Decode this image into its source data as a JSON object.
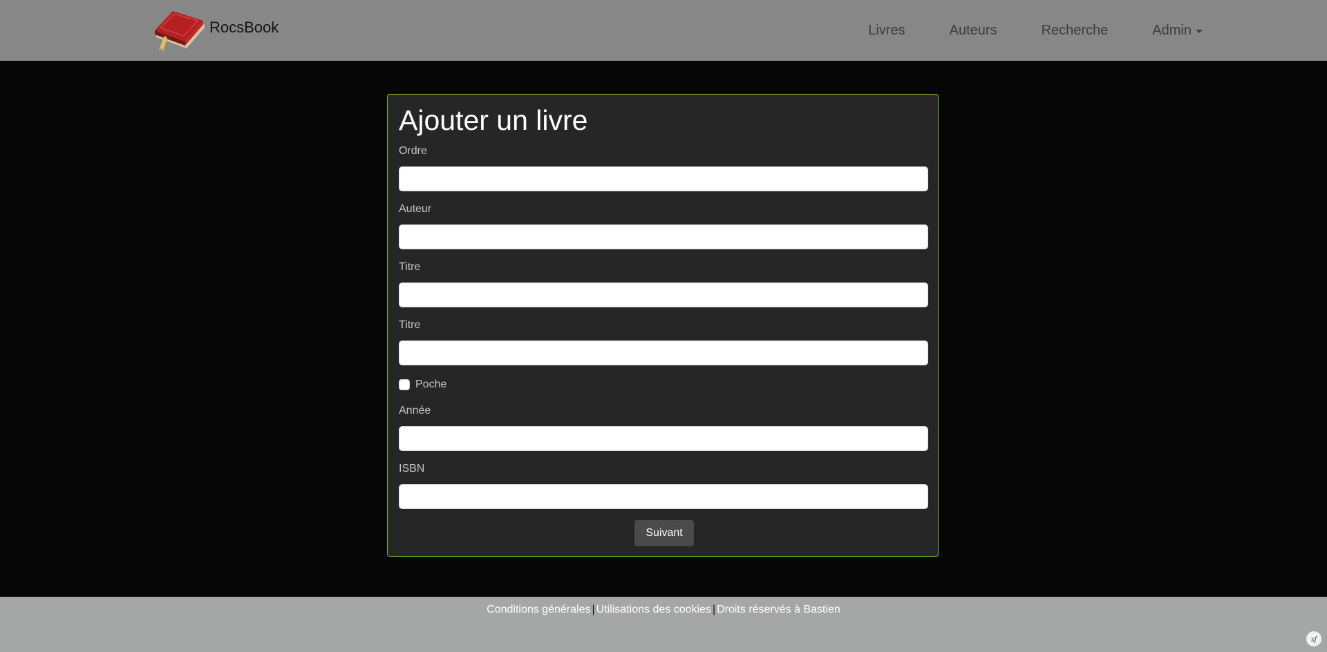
{
  "navbar": {
    "brand": "RocsBook",
    "links": [
      "Livres",
      "Auteurs",
      "Recherche"
    ],
    "dropdown": "Admin"
  },
  "form": {
    "title": "Ajouter un livre",
    "fields": {
      "ordre": {
        "label": "Ordre",
        "value": ""
      },
      "auteur": {
        "label": "Auteur",
        "value": ""
      },
      "titre1": {
        "label": "Titre",
        "value": ""
      },
      "titre2": {
        "label": "Titre",
        "value": ""
      },
      "annee": {
        "label": "Année",
        "value": ""
      },
      "isbn": {
        "label": "ISBN",
        "value": ""
      }
    },
    "checkbox": {
      "label": "Poche",
      "checked": false
    },
    "submit": "Suivant"
  },
  "footer": {
    "links": [
      "Conditions générales",
      "Utilisations des cookies",
      "Droits réservés à Bastien"
    ],
    "separator": "|"
  },
  "icons": {
    "brand_logo": "book-icon",
    "symfony_badge": "symfony-icon",
    "symfony_text": "sf"
  },
  "colors": {
    "navbar_bg": "#878787",
    "page_bg": "#060606",
    "card_bg": "#262626",
    "card_border": "#78b82a",
    "button_bg": "#4a4a4a",
    "footer_bg": "#a5a7a6"
  }
}
